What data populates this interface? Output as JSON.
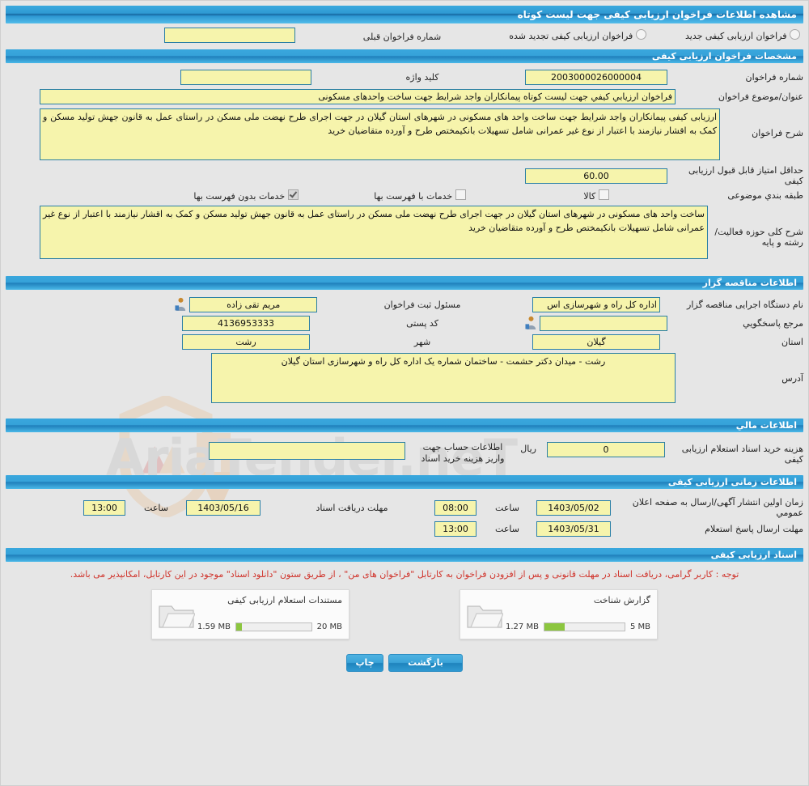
{
  "header": {
    "title": "مشاهده اطلاعات فراخوان ارزیابی کیفی جهت لیست کوتاه"
  },
  "call_type_row": {
    "new_label": "فراخوان ارزیابی کیفی جدید",
    "renewed_label": "فراخوان ارزیابی کیفی تجدید شده",
    "previous_number_label": "شماره فراخوان قبلی",
    "previous_number_value": ""
  },
  "section_specs": {
    "bar": "مشخصات فراخوان ارزیابی کیفی",
    "call_number_label": "شماره فراخوان",
    "call_number_value": "2003000026000004",
    "keyword_label": "کلید واژه",
    "keyword_value": "",
    "subject_label": "عنوان/موضوع فراخوان",
    "subject_value": "فراخوان ارزیابي کیفي جهت لیست کوتاه پیمانکاران واجد شرایط جهت ساخت واحدهای مسکونی",
    "description_label": "شرح فراخوان",
    "description_value": "ارزیابی کیفی پیمانکاران واجد شرایط جهت ساخت واحد های مسکونی در شهرهای استان گیلان در جهت اجرای طرح نهضت ملی مسکن در راستای عمل به قانون جهش تولید مسکن و کمک به اقشار نیازمند با اعتبار از نوع غیر عمرانی شامل تسهیلات بانکیمختص طرح و آورده متقاضیان خرید",
    "min_score_label": "حداقل امتیاز قابل قبول ارزیابی کیفی",
    "min_score_value": "60.00",
    "category_label": "طبقه بندي موضوعی",
    "category_options": [
      {
        "label": "کالا",
        "checked": false
      },
      {
        "label": "خدمات با فهرست بها",
        "checked": false
      },
      {
        "label": "خدمات بدون فهرست بها",
        "checked": true
      }
    ],
    "scope_label": "شرح کلی حوزه فعالیت/رشته و پایه",
    "scope_value": "ساخت واحد های مسکونی در شهرهای استان گیلان در جهت اجرای طرح نهضت ملی مسکن در راستای عمل به قانون جهش تولید مسکن و کمک به اقشار نیازمند با اعتبار از نوع غیر عمرانی شامل تسهیلات بانکیمختص طرح و آورده متقاضیان خرید"
  },
  "section_authority": {
    "bar": "اطلاعات مناقصه گزار",
    "agency_label": "نام دستگاه اجرایی مناقصه گزار",
    "agency_value": "اداره کل راه و شهرسازی اس",
    "registrar_label": "مسئول ثبت فراخوان",
    "registrar_value": "مریم تقی زاده",
    "contact_label": "مرجع پاسخگویي",
    "contact_value": "",
    "postal_label": "کد پستی",
    "postal_value": "4136953333",
    "province_label": "استان",
    "province_value": "گیلان",
    "city_label": "شهر",
    "city_value": "رشت",
    "address_label": "آدرس",
    "address_value": "رشت - میدان دکتر حشمت - ساختمان شماره یک اداره کل راه و شهرسازی استان گیلان"
  },
  "section_financial": {
    "bar": "اطلاعات مالي",
    "doc_cost_label": "هزینه خرید اسناد استعلام ارزیابی کیفی",
    "doc_cost_value": "0",
    "currency_label": "ریال",
    "account_label": "اطلاعات حساب جهت واریز هزینه خرید اسناد",
    "account_value": ""
  },
  "section_time": {
    "bar": "اطلاعات زمانی ارزیابی کیفی",
    "rows": [
      {
        "label": "زمان اولین انتشار آگهی/ارسال به صفحه اعلان عمومي",
        "date": "1403/05/02",
        "time_label": "ساعت",
        "time": "08:00",
        "second_label": "مهلت دریافت اسناد",
        "second_date": "1403/05/16",
        "second_time_label": "ساعت",
        "second_time": "13:00"
      },
      {
        "label": "مهلت ارسال پاسخ استعلام",
        "date": "1403/05/31",
        "time_label": "ساعت",
        "time": "13:00",
        "second_label": "",
        "second_date": "",
        "second_time_label": "",
        "second_time": ""
      }
    ]
  },
  "section_documents": {
    "bar": "اسناد ارزیابی کیفی",
    "note": "توجه : کاربر گرامی، دریافت اسناد در مهلت قانونی و پس از افزودن فراخوان به کارتابل \"فراخوان های من\" ، از طریق ستون \"دانلود اسناد\" موجود در این کارتابل، امکانپذیر می باشد.",
    "cards": [
      {
        "title": "گزارش شناخت",
        "size": "1.27 MB",
        "limit": "5 MB",
        "percent": 25
      },
      {
        "title": "مستندات استعلام ارزیابی کیفی",
        "size": "1.59 MB",
        "limit": "20 MB",
        "percent": 8
      }
    ]
  },
  "footer": {
    "print_label": "چاپ",
    "back_label": "بازگشت"
  },
  "colors": {
    "accent": "#36a2d9",
    "input_bg": "#f6f4ac",
    "input_border": "#2a7fa5",
    "page_bg": "#e6e6e6",
    "note_red": "#d0342c",
    "meter_green": "#8cc63f"
  }
}
